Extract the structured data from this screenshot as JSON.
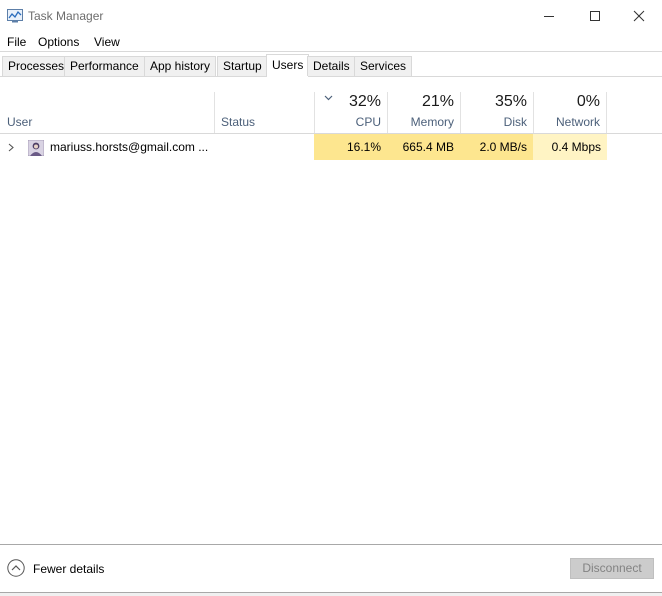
{
  "window": {
    "title": "Task Manager"
  },
  "menu": {
    "items": [
      "File",
      "Options",
      "View"
    ]
  },
  "tabs": [
    {
      "label": "Processes"
    },
    {
      "label": "Performance"
    },
    {
      "label": "App history"
    },
    {
      "label": "Startup"
    },
    {
      "label": "Users",
      "active": true
    },
    {
      "label": "Details"
    },
    {
      "label": "Services"
    }
  ],
  "columns": {
    "user": "User",
    "status": "Status",
    "cpu": {
      "percent": "32%",
      "label": "CPU"
    },
    "memory": {
      "percent": "21%",
      "label": "Memory"
    },
    "disk": {
      "percent": "35%",
      "label": "Disk"
    },
    "network": {
      "percent": "0%",
      "label": "Network"
    }
  },
  "rows": [
    {
      "user": "mariuss.horsts@gmail.com ...",
      "status": "",
      "cpu": "16.1%",
      "memory": "665.4 MB",
      "disk": "2.0 MB/s",
      "network": "0.4 Mbps"
    }
  ],
  "footer": {
    "fewer_details": "Fewer details",
    "disconnect": "Disconnect"
  },
  "colors": {
    "heat_high": "#fde68f",
    "heat_low": "#fff4c4",
    "header_label": "#4c607a"
  }
}
